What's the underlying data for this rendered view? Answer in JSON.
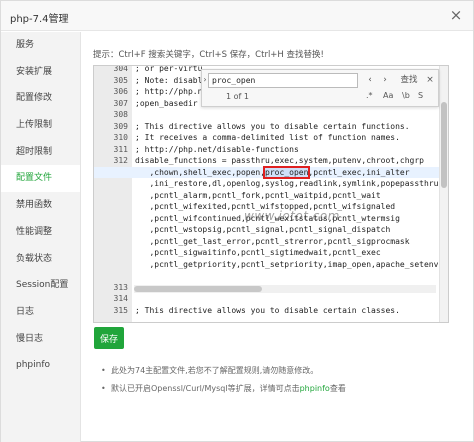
{
  "window": {
    "title": "php-7.4管理",
    "close_label": "×"
  },
  "sidebar": {
    "items": [
      "服务",
      "安装扩展",
      "配置修改",
      "上传限制",
      "超时限制",
      "配置文件",
      "禁用函数",
      "性能调整",
      "负载状态",
      "Session配置",
      "日志",
      "慢日志",
      "phpinfo"
    ],
    "active_index": 5
  },
  "hint": "提示：Ctrl+F 搜索关键字，Ctrl+S 保存，Ctrl+H 查找替换!",
  "editor": {
    "lines": [
      {
        "n": "304",
        "t": "; or per-virtu"
      },
      {
        "n": "305",
        "t": "; Note: disabl"
      },
      {
        "n": "306",
        "t": "; http://php.n"
      },
      {
        "n": "307",
        "t": ";open_basedir ="
      },
      {
        "n": "308",
        "t": ""
      },
      {
        "n": "309",
        "t": "; This directive allows you to disable certain functions."
      },
      {
        "n": "310",
        "t": "; It receives a comma-delimited list of function names."
      },
      {
        "n": "311",
        "t": "; http://php.net/disable-functions"
      },
      {
        "n": "312",
        "t": "disable_functions = passthru,exec,system,putenv,chroot,chgrp"
      },
      {
        "n": "",
        "t": "   ,chown,shell_exec,popen,",
        "hl": "proc_open",
        "post": ",pcntl_exec,ini_alter"
      },
      {
        "n": "",
        "t": "   ,ini_restore,dl,openlog,syslog,readlink,symlink,popepassthru"
      },
      {
        "n": "",
        "t": "   ,pcntl_alarm,pcntl_fork,pcntl_waitpid,pcntl_wait"
      },
      {
        "n": "",
        "t": "   ,pcntl_wifexited,pcntl_wifstopped,pcntl_wifsignaled"
      },
      {
        "n": "",
        "t": "   ,pcntl_wifcontinued,pcntl_wexitstatus,pcntl_wtermsig"
      },
      {
        "n": "",
        "t": "   ,pcntl_wstopsig,pcntl_signal,pcntl_signal_dispatch"
      },
      {
        "n": "",
        "t": "   ,pcntl_get_last_error,pcntl_strerror,pcntl_sigprocmask"
      },
      {
        "n": "",
        "t": "   ,pcntl_sigwaitinfo,pcntl_sigtimedwait,pcntl_exec"
      },
      {
        "n": "",
        "t": "   ,pcntl_getpriority,pcntl_setpriority,imap_open,apache_setenv"
      },
      {
        "n": "",
        "t": ""
      },
      {
        "n": "313",
        "t": ""
      },
      {
        "n": "314",
        "t": ""
      },
      {
        "n": "315",
        "t": "; This directive allows you to disable certain classes."
      }
    ],
    "current_line_index": 9
  },
  "find": {
    "query": "proc_open",
    "prev_label": "‹",
    "next_label": "›",
    "search_label": "查找",
    "close_label": "×",
    "expand_label": "›",
    "count": "1 of 1",
    "opt_regex": ".*",
    "opt_case": "Aa",
    "opt_word": "\\b",
    "opt_selection": "S"
  },
  "watermark": "www.iotot.com",
  "save_label": "保存",
  "notes": [
    {
      "text": "此处为74主配置文件,若您不了解配置规则,请勿随意修改。"
    },
    {
      "text": "默认已开启Openssl/Curl/Mysql等扩展，详情可点击",
      "link": "phpinfo",
      "after": "查看"
    }
  ]
}
